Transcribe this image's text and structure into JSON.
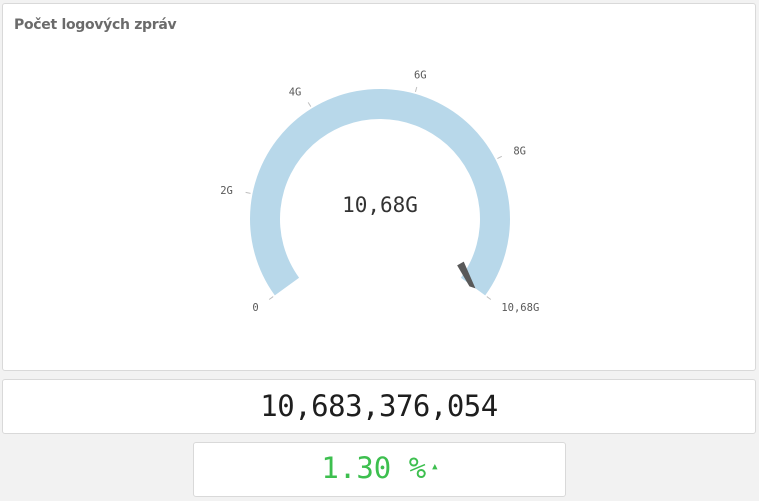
{
  "gauge": {
    "title": "Počet logových zpráv",
    "center_label": "10,68G",
    "colors": {
      "track": "#b8d8ea",
      "needle": "#595959",
      "tick": "#bfbfbf"
    }
  },
  "total": {
    "value": "10,683,376,054"
  },
  "change": {
    "value": "1.30 %",
    "arrow": "▲",
    "color": "#3dbf4f"
  },
  "chart_data": {
    "type": "gauge",
    "value": 10.68,
    "range": [
      0,
      10.68
    ],
    "ticks": [
      {
        "value": 0,
        "label": "0"
      },
      {
        "value": 2,
        "label": "2G"
      },
      {
        "value": 4,
        "label": "4G"
      },
      {
        "value": 6,
        "label": "6G"
      },
      {
        "value": 8,
        "label": "8G"
      },
      {
        "value": 10.68,
        "label": "10,68G"
      }
    ]
  }
}
